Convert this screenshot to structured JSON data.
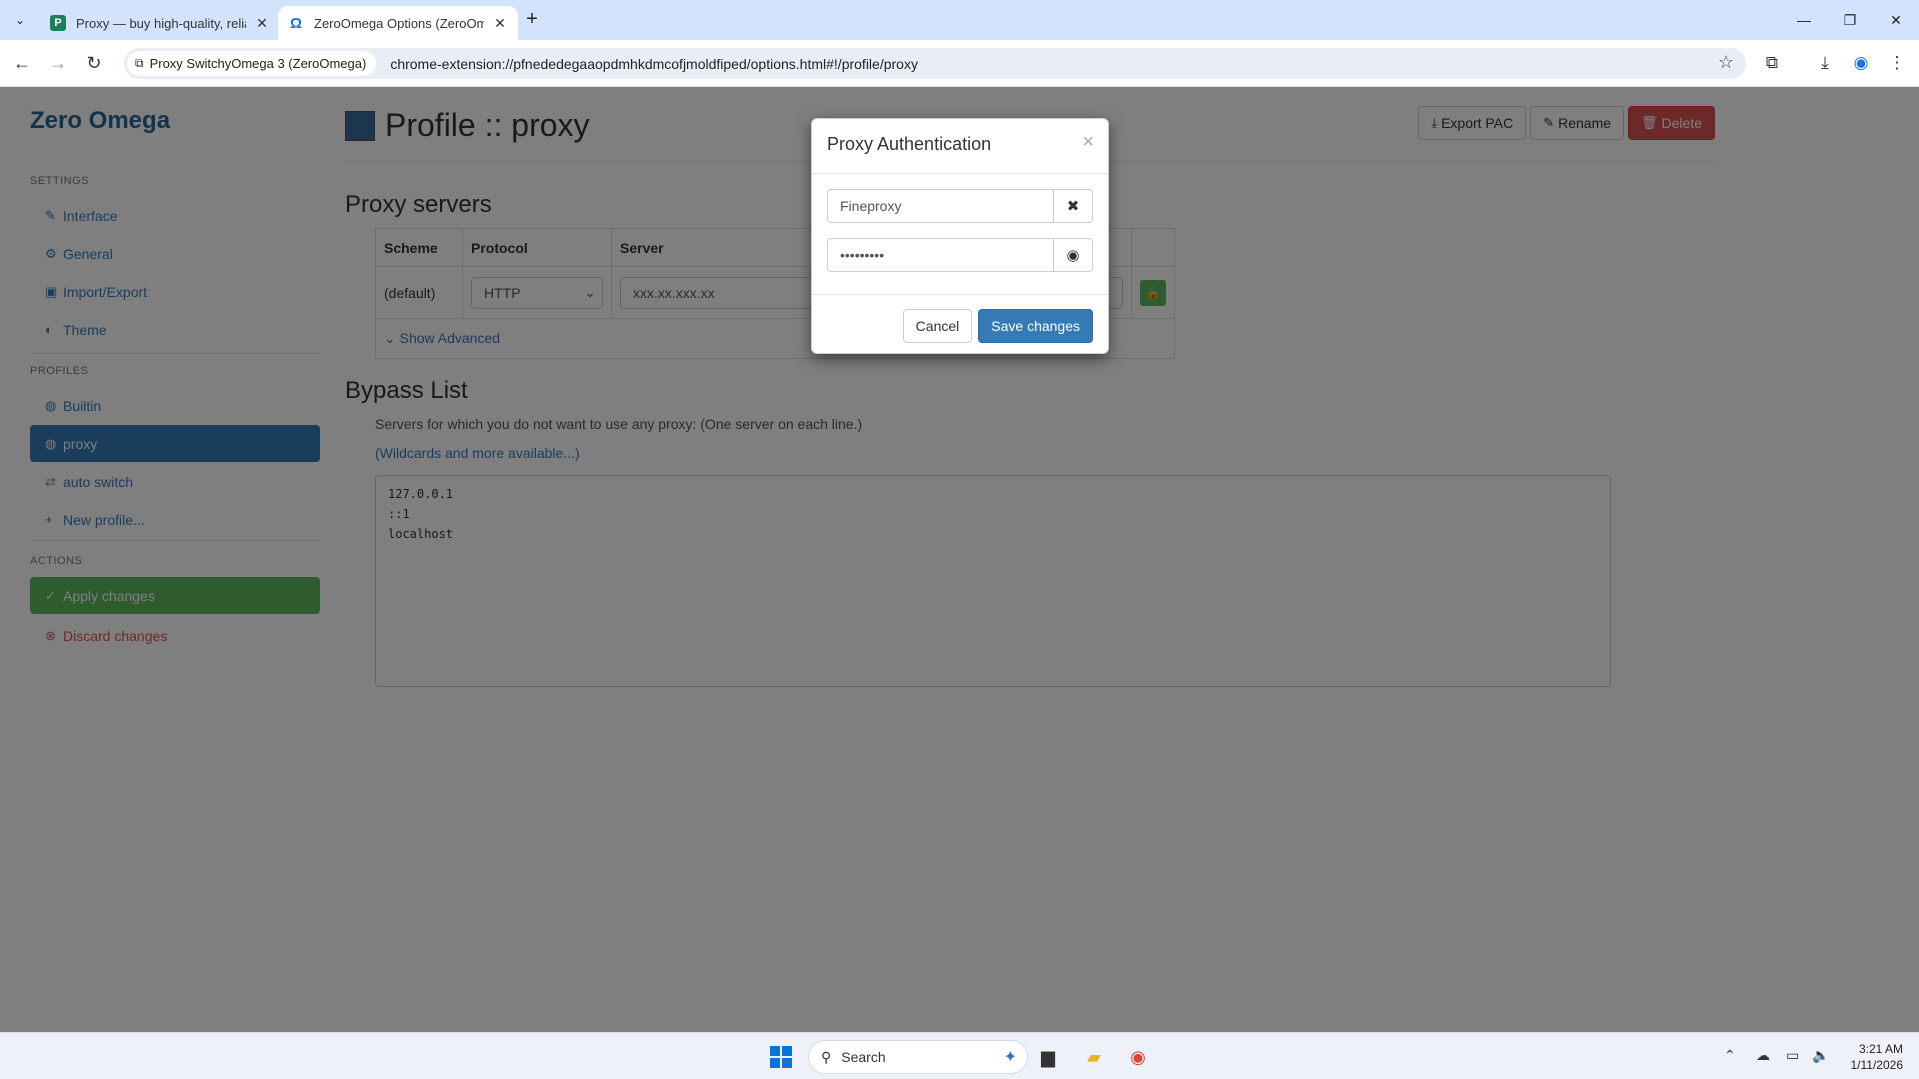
{
  "browser": {
    "tabs": [
      {
        "title": "Proxy — buy high-quality, relia",
        "favicon": "P"
      },
      {
        "title": "ZeroOmega Options (ZeroOme",
        "favicon": "Ω"
      }
    ],
    "site_chip": "Proxy SwitchyOmega 3 (ZeroOmega)",
    "url": "chrome-extension://pfnededegaaopdmhkdmcofjmoldfiped/options.html#!/profile/proxy"
  },
  "sidebar": {
    "brand": "Zero Omega",
    "settings_header": "SETTINGS",
    "settings_items": [
      "Interface",
      "General",
      "Import/Export",
      "Theme"
    ],
    "profiles_header": "PROFILES",
    "profile_items": [
      "Builtin",
      "proxy",
      "auto switch",
      "New profile..."
    ],
    "actions_header": "ACTIONS",
    "apply": "Apply changes",
    "discard": "Discard changes"
  },
  "main": {
    "title": "Profile :: proxy",
    "profile_color": "#3d6b9c",
    "export_pac": "Export PAC",
    "rename": "Rename",
    "delete": "Delete",
    "proxy_servers_title": "Proxy servers",
    "table_headers": [
      "Scheme",
      "Protocol",
      "Server"
    ],
    "row_scheme": "(default)",
    "row_protocol": "HTTP",
    "row_server": "xxx.xx.xxx.xx",
    "show_advanced": "Show Advanced",
    "bypass_title": "Bypass List",
    "bypass_help": "Servers for which you do not want to use any proxy: (One server on each line.)",
    "bypass_link": "(Wildcards and more available...)",
    "bypass_lines": [
      "127.0.0.1",
      "::1",
      "localhost"
    ]
  },
  "modal": {
    "title": "Proxy Authentication",
    "username": "Fineproxy",
    "password_mask": "•••••••••",
    "cancel": "Cancel",
    "save": "Save changes"
  },
  "taskbar": {
    "search_placeholder": "Search",
    "time": "3:21 AM",
    "date": "1/11/2026"
  }
}
